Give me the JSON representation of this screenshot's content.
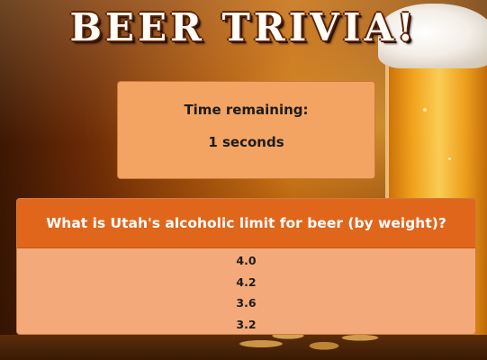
{
  "title": "BEER TRIVIA!",
  "timer": {
    "label": "Time remaining:",
    "value": "1 seconds"
  },
  "question": {
    "text": "What is Utah's alcoholic limit for beer (by weight)?",
    "answers": [
      "4.0",
      "4.2",
      "3.6",
      "3.2"
    ]
  },
  "colors": {
    "timer_panel": "#f4a462",
    "question_header": "#e0661c",
    "answers_panel": "#f4a97a"
  }
}
